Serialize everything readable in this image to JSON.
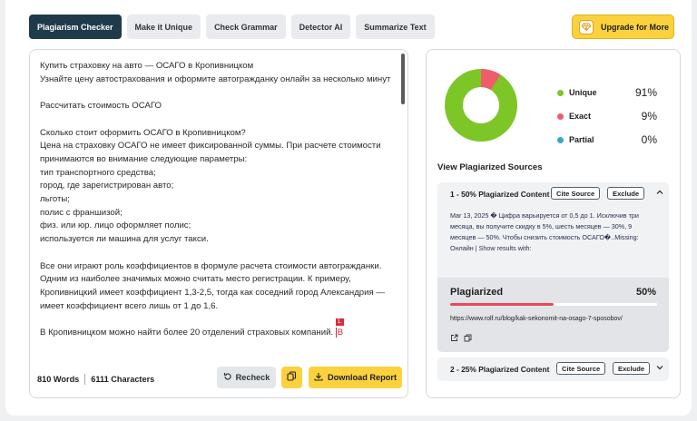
{
  "tabs": [
    "Plagiarism Checker",
    "Make it Unique",
    "Check Grammar",
    "Detector AI",
    "Summarize Text"
  ],
  "upgrade": {
    "label": "Upgrade for More",
    "icon": "gem-icon"
  },
  "editor": {
    "paragraphs": [
      "Купить страховку на авто — ОСАГО в Кропивницком\nУзнайте цену автострахования и оформите автогражданку онлайн за несколько минут",
      "Рассчитать стоимость ОСАГО",
      "Сколько стоит оформить ОСАГО в Кропивницком?\nЦена на страховку ОСАГО не имеет фиксированной суммы. При расчете стоимости принимаются во внимание следующие параметры:\nтип транспортного средства;\nгород, где зарегистрирован авто;\nльготы;\nполис с франшизой;\nфиз. или юр. лицо оформляет полис;\nиспользуется ли машина для услуг такси.",
      "Все они играют роль коэффициентов в формуле расчета стоимости автогражданки. Одним из наиболее значимых можно считать место регистрации. К примеру, Кропивницкий имеет коэффициент 1,3-2,5, тогда как соседний город Александрия — имеет коэффициент всего лишь от 1 до 1,6."
    ],
    "last_line": "В Кропивницком можно найти более 20 отделений страховых компаний.",
    "cursor_char": "В",
    "cursor_flag": "1.",
    "words": "810 Words",
    "characters": "6111 Characters",
    "recheck_label": "Recheck",
    "download_label": "Download Report"
  },
  "stats": {
    "items": [
      {
        "label": "Unique",
        "value": "91%",
        "color": "#7cc627"
      },
      {
        "label": "Exact",
        "value": "9%",
        "color": "#ef5d6b"
      },
      {
        "label": "Partial",
        "value": "0%",
        "color": "#3aa6cc"
      }
    ],
    "unique_fraction": 0.91,
    "exact_fraction": 0.09
  },
  "sources_title": "View Plagiarized Sources",
  "sources": [
    {
      "title": "1 - 50% Plagiarized Content",
      "cite": "Cite Source",
      "exclude": "Exclude",
      "snippet": "Mar 13, 2025 � Цифра варьируется от 0,5 до 1. Исключив три месяца, вы получите скидку в 5%, шесть месяцев — 30%, 9 месяцев — 50%. Чтобы снизить стоимость ОСАГО�..Missing: Онлайн | Show results with:",
      "plag_label": "Plagiarized",
      "plag_value": "50%",
      "plag_fraction": 0.5,
      "url": "https://www.rolf.ru/blog/kak-sekonomit-na-osago-7-sposobov/"
    },
    {
      "title": "2 - 25% Plagiarized Content",
      "cite": "Cite Source",
      "exclude": "Exclude"
    }
  ]
}
